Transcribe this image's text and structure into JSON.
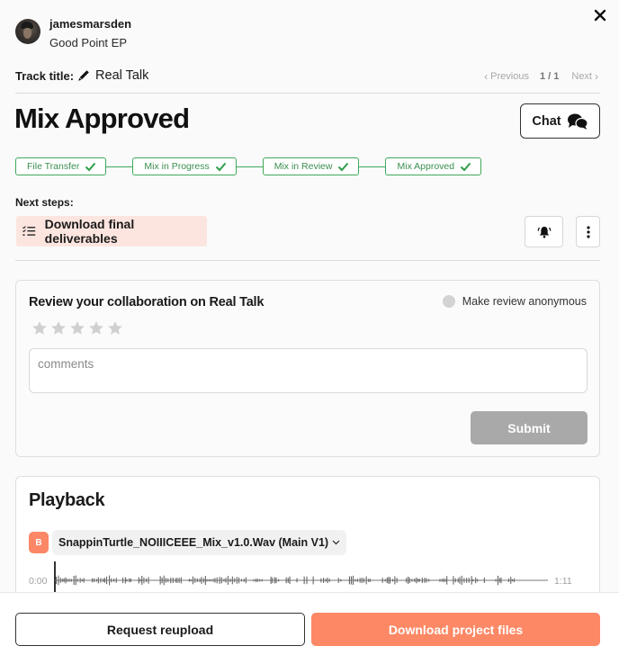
{
  "header": {
    "username": "jamesmarsden",
    "project_name": "Good Point EP",
    "track_label": "Track title:",
    "track_title": "Real Talk",
    "pager": {
      "previous_label": "Previous",
      "count": "1 / 1",
      "next_label": "Next"
    }
  },
  "status": {
    "title": "Mix Approved",
    "chat_label": "Chat"
  },
  "steps": [
    {
      "label": "File Transfer",
      "completed": true
    },
    {
      "label": "Mix in Progress",
      "completed": true
    },
    {
      "label": "Mix in Review",
      "completed": true
    },
    {
      "label": "Mix Approved",
      "completed": true
    }
  ],
  "next_steps": {
    "label": "Next steps:",
    "item": "Download final deliverables"
  },
  "review": {
    "title": "Review your collaboration on Real Talk",
    "anonymous_label": "Make review anonymous",
    "anonymous_checked": false,
    "rating": 0,
    "max_rating": 5,
    "comments_placeholder": "comments",
    "comments_value": "",
    "submit_label": "Submit"
  },
  "playback": {
    "title": "Playback",
    "badge": "B",
    "file_name": "SnappinTurtle_NOIIICEEE_Mix_v1.0.Wav (Main V1)",
    "time_start": "0:00",
    "time_end": "1:11"
  },
  "footer": {
    "request_reupload_label": "Request reupload",
    "download_label": "Download project files"
  },
  "colors": {
    "accent": "#fd8865",
    "step_green": "#3fa95a",
    "next_step_bg": "#fde5df",
    "submit_disabled": "#a9a9a9"
  }
}
